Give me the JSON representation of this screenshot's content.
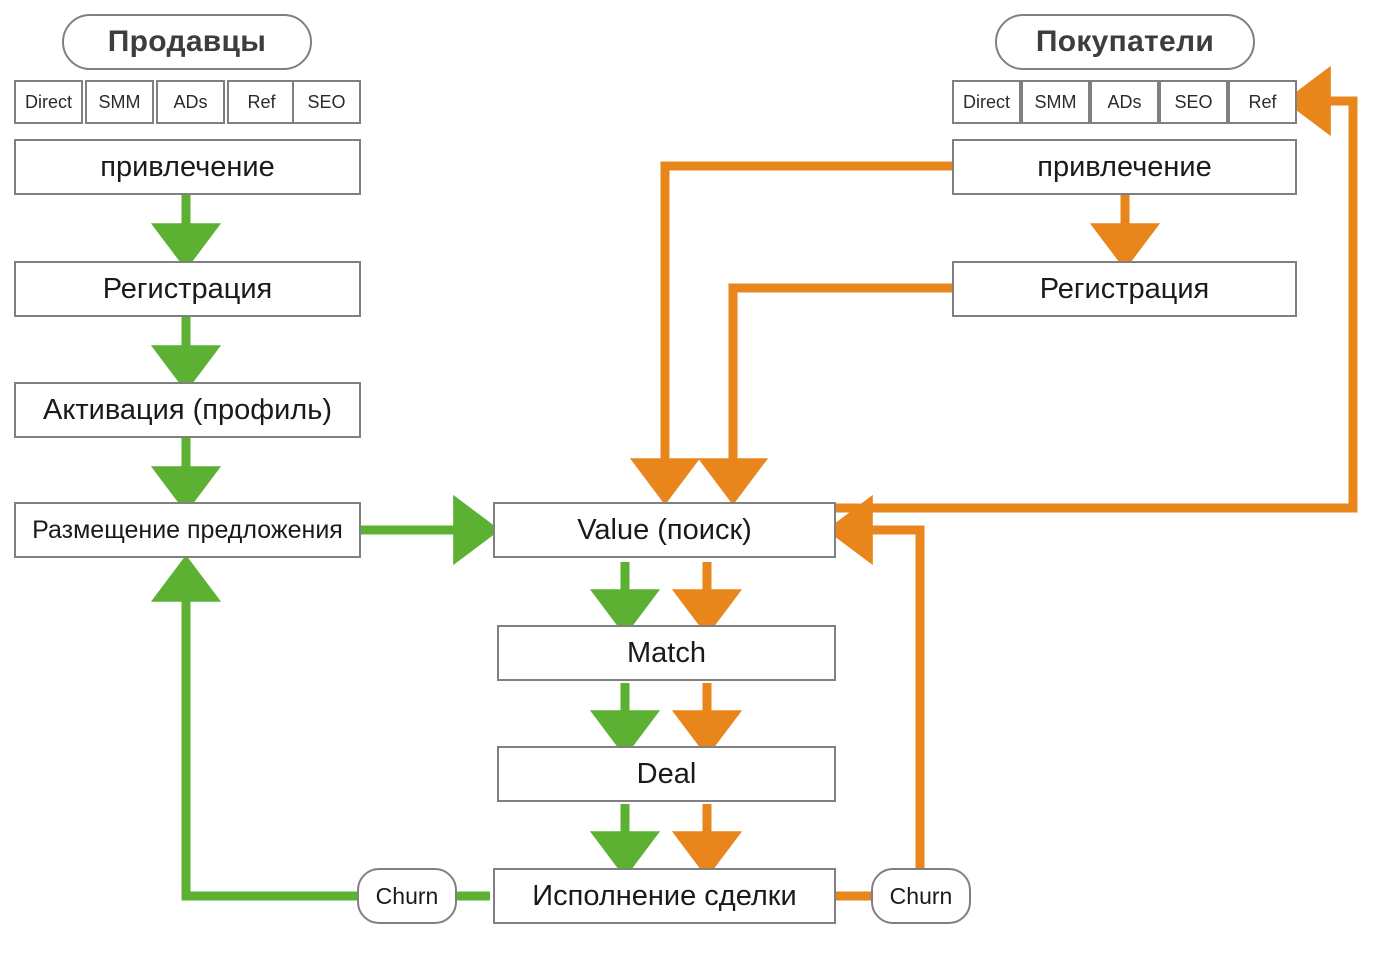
{
  "diagram": {
    "title_sellers": "Продавцы",
    "title_buyers": "Покупатели",
    "colors": {
      "green": "#5cb032",
      "orange": "#e8861b",
      "box_border": "#808080",
      "pill_border": "#757575",
      "text": "#1a1a1a",
      "background": "#ffffff"
    }
  },
  "sellers": {
    "title": "Продавцы",
    "channels": [
      "Direct",
      "SMM",
      "ADs",
      "Ref",
      "SEO"
    ],
    "steps": [
      "привлечение",
      "Регистрация",
      "Активация (профиль)",
      "Размещение предложения"
    ],
    "churn_label": "Churn"
  },
  "buyers": {
    "title": "Покупатели",
    "channels": [
      "Direct",
      "SMM",
      "ADs",
      "SEO",
      "Ref"
    ],
    "steps": [
      "привлечение",
      "Регистрация"
    ],
    "churn_label": "Churn"
  },
  "center": {
    "steps": [
      "Value (поиск)",
      "Match",
      "Deal",
      "Исполнение сделки"
    ]
  },
  "chart_data": {
    "type": "diagram",
    "title": "Marketplace two-sided funnel",
    "nodes": [
      {
        "id": "sellers-title",
        "label": "Продавцы",
        "shape": "pill",
        "lane": "sellers"
      },
      {
        "id": "seller-ch-direct",
        "label": "Direct",
        "shape": "chip",
        "lane": "sellers"
      },
      {
        "id": "seller-ch-smm",
        "label": "SMM",
        "shape": "chip",
        "lane": "sellers"
      },
      {
        "id": "seller-ch-ads",
        "label": "ADs",
        "shape": "chip",
        "lane": "sellers"
      },
      {
        "id": "seller-ch-ref",
        "label": "Ref",
        "shape": "chip",
        "lane": "sellers"
      },
      {
        "id": "seller-ch-seo",
        "label": "SEO",
        "shape": "chip",
        "lane": "sellers"
      },
      {
        "id": "seller-acq",
        "label": "привлечение",
        "shape": "rect",
        "lane": "sellers"
      },
      {
        "id": "seller-reg",
        "label": "Регистрация",
        "shape": "rect",
        "lane": "sellers"
      },
      {
        "id": "seller-act",
        "label": "Активация (профиль)",
        "shape": "rect",
        "lane": "sellers"
      },
      {
        "id": "seller-offer",
        "label": "Размещение предложения",
        "shape": "rect",
        "lane": "sellers"
      },
      {
        "id": "buyers-title",
        "label": "Покупатели",
        "shape": "pill",
        "lane": "buyers"
      },
      {
        "id": "buyer-ch-direct",
        "label": "Direct",
        "shape": "chip",
        "lane": "buyers"
      },
      {
        "id": "buyer-ch-smm",
        "label": "SMM",
        "shape": "chip",
        "lane": "buyers"
      },
      {
        "id": "buyer-ch-ads",
        "label": "ADs",
        "shape": "chip",
        "lane": "buyers"
      },
      {
        "id": "buyer-ch-seo",
        "label": "SEO",
        "shape": "chip",
        "lane": "buyers"
      },
      {
        "id": "buyer-ch-ref",
        "label": "Ref",
        "shape": "chip",
        "lane": "buyers"
      },
      {
        "id": "buyer-acq",
        "label": "привлечение",
        "shape": "rect",
        "lane": "buyers"
      },
      {
        "id": "buyer-reg",
        "label": "Регистрация",
        "shape": "rect",
        "lane": "buyers"
      },
      {
        "id": "value",
        "label": "Value (поиск)",
        "shape": "rect",
        "lane": "center"
      },
      {
        "id": "match",
        "label": "Match",
        "shape": "rect",
        "lane": "center"
      },
      {
        "id": "deal",
        "label": "Deal",
        "shape": "rect",
        "lane": "center"
      },
      {
        "id": "fulfil",
        "label": "Исполнение сделки",
        "shape": "rect",
        "lane": "center"
      },
      {
        "id": "churn-left",
        "label": "Churn",
        "shape": "pill",
        "lane": "sellers"
      },
      {
        "id": "churn-right",
        "label": "Churn",
        "shape": "pill",
        "lane": "buyers"
      }
    ],
    "edges": [
      {
        "from": "seller-acq",
        "to": "seller-reg",
        "color": "green"
      },
      {
        "from": "seller-reg",
        "to": "seller-act",
        "color": "green"
      },
      {
        "from": "seller-act",
        "to": "seller-offer",
        "color": "green"
      },
      {
        "from": "seller-offer",
        "to": "value",
        "color": "green"
      },
      {
        "from": "buyer-acq",
        "to": "buyer-reg",
        "color": "orange"
      },
      {
        "from": "buyer-acq",
        "to": "value",
        "color": "orange"
      },
      {
        "from": "buyer-reg",
        "to": "value",
        "color": "orange"
      },
      {
        "from": "value",
        "to": "match",
        "color": "green"
      },
      {
        "from": "value",
        "to": "match",
        "color": "orange"
      },
      {
        "from": "match",
        "to": "deal",
        "color": "green"
      },
      {
        "from": "match",
        "to": "deal",
        "color": "orange"
      },
      {
        "from": "deal",
        "to": "fulfil",
        "color": "green"
      },
      {
        "from": "deal",
        "to": "fulfil",
        "color": "orange"
      },
      {
        "from": "fulfil",
        "to": "churn-left",
        "color": "green"
      },
      {
        "from": "churn-left",
        "to": "seller-offer",
        "color": "green"
      },
      {
        "from": "fulfil",
        "to": "churn-right",
        "color": "orange"
      },
      {
        "from": "churn-right",
        "to": "value",
        "color": "orange"
      },
      {
        "from": "value",
        "to": "buyer-ch-ref",
        "color": "orange"
      }
    ]
  }
}
